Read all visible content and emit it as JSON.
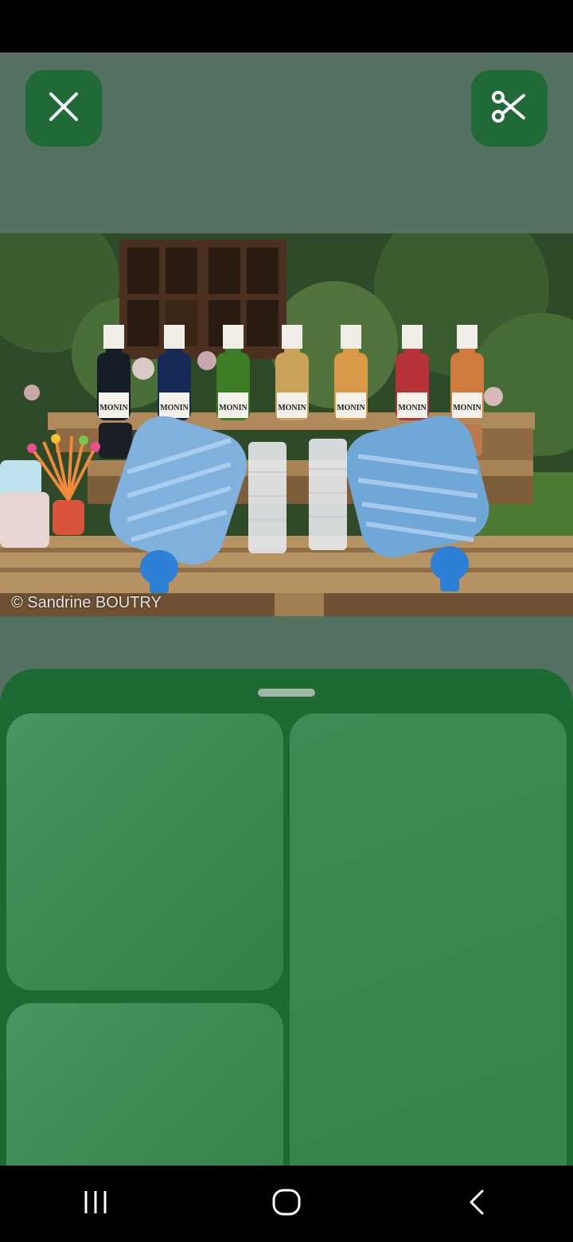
{
  "toolbar": {
    "close_icon": "close-icon",
    "cut_icon": "scissors-icon"
  },
  "image": {
    "watermark": "© Sandrine BOUTRY",
    "bottle_label": "MONIN"
  },
  "sheet": {
    "cards": [
      "card-1",
      "card-2",
      "card-3"
    ]
  },
  "nav": {
    "recents_icon": "recents-icon",
    "home_icon": "home-icon",
    "back_icon": "back-icon"
  },
  "colors": {
    "viewer_bg": "#557161",
    "button_bg": "#1f6a36",
    "sheet_bg": "#1d6a33",
    "card_bg": "#3c8a54"
  }
}
